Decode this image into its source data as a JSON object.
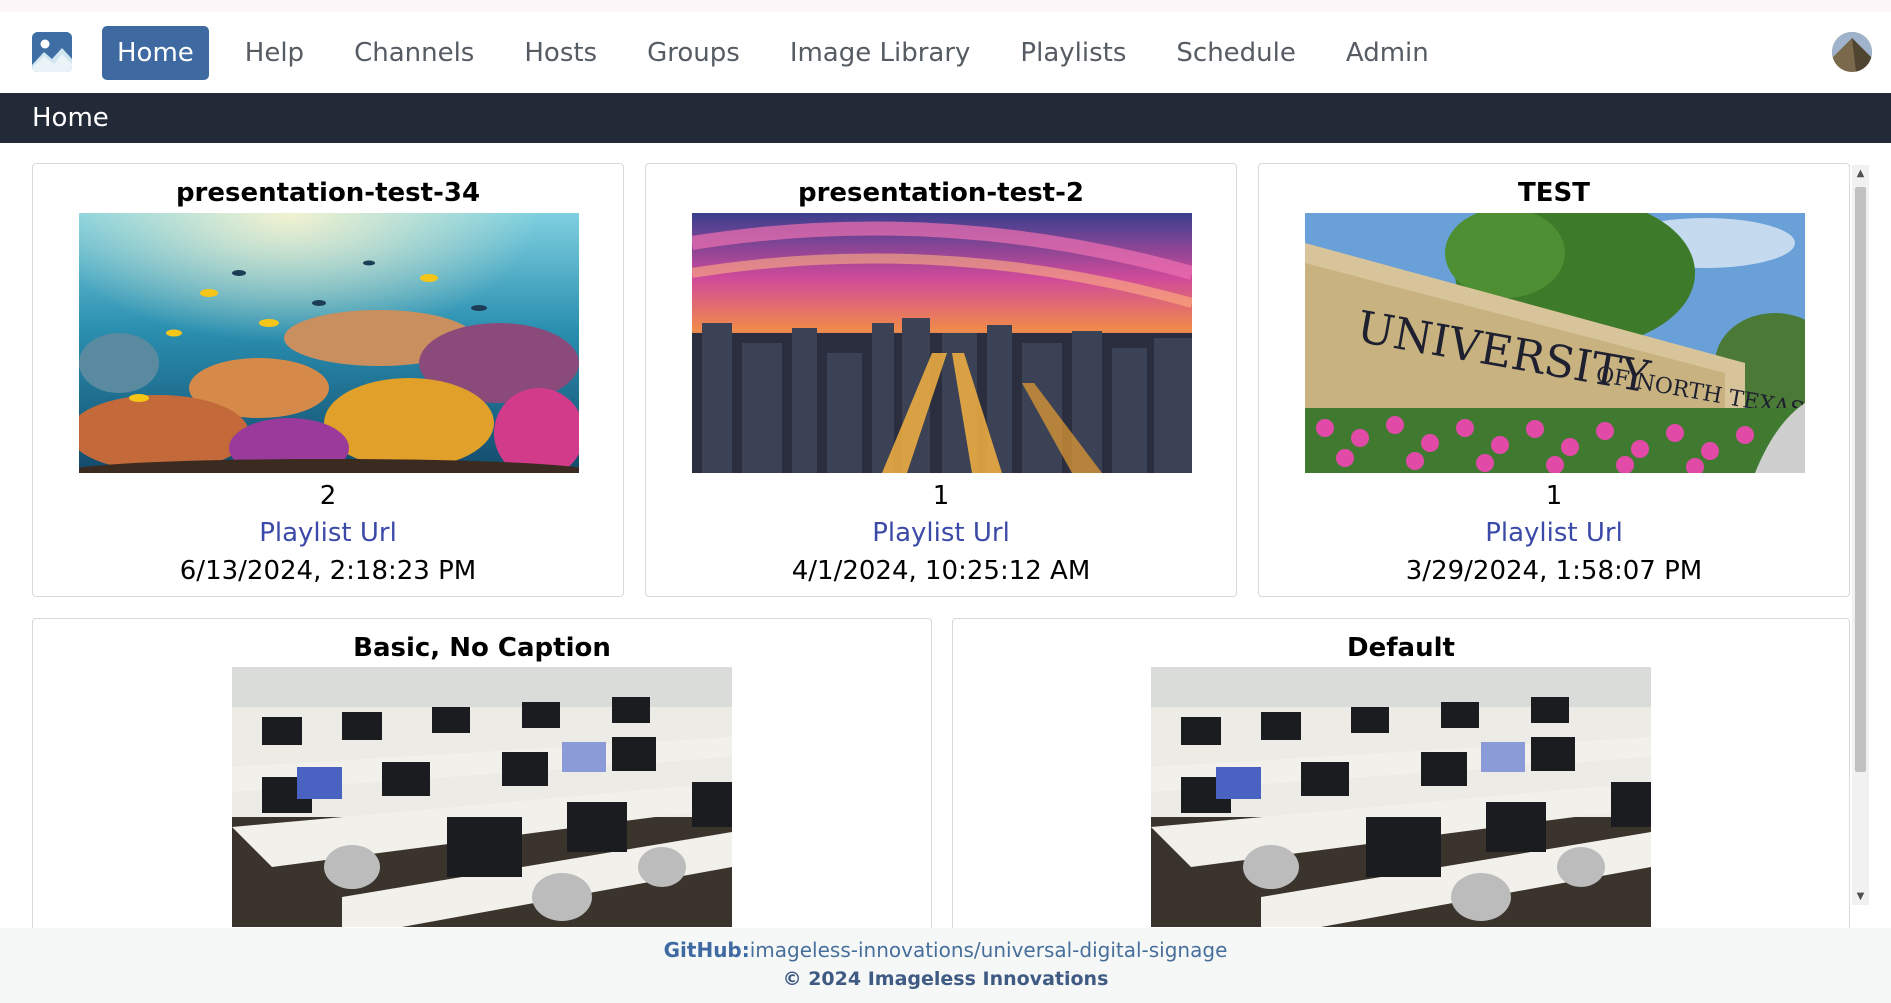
{
  "nav": {
    "items": [
      {
        "label": "Home",
        "active": true
      },
      {
        "label": "Help"
      },
      {
        "label": "Channels"
      },
      {
        "label": "Hosts"
      },
      {
        "label": "Groups"
      },
      {
        "label": "Image Library"
      },
      {
        "label": "Playlists"
      },
      {
        "label": "Schedule"
      },
      {
        "label": "Admin"
      }
    ],
    "logo_icon": "image-icon",
    "avatar_icon": "user-avatar"
  },
  "breadcrumb": {
    "title": "Home"
  },
  "cards": [
    {
      "title": "presentation-test-34",
      "count": "2",
      "link": "Playlist Url",
      "date": "6/13/2024, 2:18:23 PM",
      "image": "coral-reef"
    },
    {
      "title": "presentation-test-2",
      "count": "1",
      "link": "Playlist Url",
      "date": "4/1/2024, 10:25:12 AM",
      "image": "city-sunset"
    },
    {
      "title": "TEST",
      "count": "1",
      "link": "Playlist Url",
      "date": "3/29/2024, 1:58:07 PM",
      "image": "university-sign"
    },
    {
      "title": "Basic, No Caption",
      "image": "computer-lab"
    },
    {
      "title": "Default",
      "image": "computer-lab"
    }
  ],
  "footer": {
    "github_label": "GitHub:",
    "github_repo": "imageless-innovations/universal-digital-signage",
    "copyright": "© 2024 Imageless Innovations"
  },
  "colors": {
    "nav_active": "#3f6aa1",
    "breadcrumb_bg": "#222937",
    "link": "#3b4aa8"
  }
}
